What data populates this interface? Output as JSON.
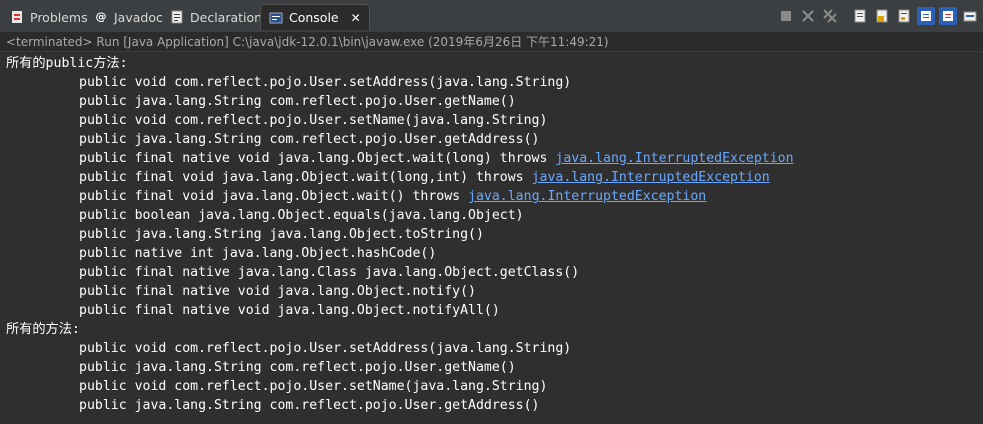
{
  "tabs": [
    {
      "label": "Problems",
      "icon": "problems-icon"
    },
    {
      "label": "Javadoc",
      "icon": "javadoc-icon"
    },
    {
      "label": "Declaration",
      "icon": "declaration-icon"
    },
    {
      "label": "Console",
      "icon": "console-icon",
      "active": true
    }
  ],
  "status": "<terminated> Run [Java Application] C:\\java\\jdk-12.0.1\\bin\\javaw.exe (2019年6月26日 下午11:49:21)",
  "console": {
    "header_public": "所有的public方法:",
    "public_lines": [
      {
        "text": "public void com.reflect.pojo.User.setAddress(java.lang.String)"
      },
      {
        "text": "public java.lang.String com.reflect.pojo.User.getName()"
      },
      {
        "text": "public void com.reflect.pojo.User.setName(java.lang.String)"
      },
      {
        "text": "public java.lang.String com.reflect.pojo.User.getAddress()"
      },
      {
        "text": "public final native void java.lang.Object.wait(long) throws ",
        "link": "java.lang.InterruptedException"
      },
      {
        "text": "public final void java.lang.Object.wait(long,int) throws ",
        "link": "java.lang.InterruptedException"
      },
      {
        "text": "public final void java.lang.Object.wait() throws ",
        "link": "java.lang.InterruptedException"
      },
      {
        "text": "public boolean java.lang.Object.equals(java.lang.Object)"
      },
      {
        "text": "public java.lang.String java.lang.Object.toString()"
      },
      {
        "text": "public native int java.lang.Object.hashCode()"
      },
      {
        "text": "public final native java.lang.Class java.lang.Object.getClass()"
      },
      {
        "text": "public final native void java.lang.Object.notify()"
      },
      {
        "text": "public final native void java.lang.Object.notifyAll()"
      }
    ],
    "header_all": "所有的方法:",
    "all_lines": [
      {
        "text": "public void com.reflect.pojo.User.setAddress(java.lang.String)"
      },
      {
        "text": "public java.lang.String com.reflect.pojo.User.getName()"
      },
      {
        "text": "public void com.reflect.pojo.User.setName(java.lang.String)"
      },
      {
        "text": "public java.lang.String com.reflect.pojo.User.getAddress()"
      }
    ]
  },
  "colors": {
    "background": "#2f2f2f",
    "text": "#ffffff",
    "link": "#6aa9ff"
  }
}
